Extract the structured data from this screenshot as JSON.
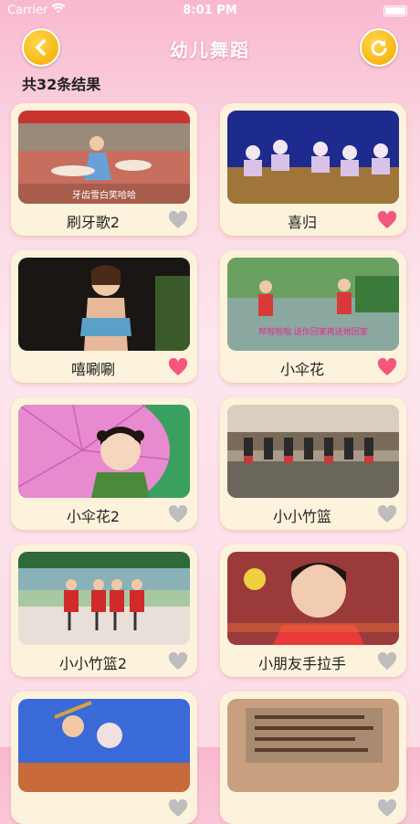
{
  "status_bar": {
    "carrier": "Carrier",
    "time": "8:01 PM"
  },
  "nav": {
    "title": "幼儿舞蹈",
    "back_icon": "chevron-left-icon",
    "refresh_icon": "refresh-icon"
  },
  "result_count": "共32条结果",
  "colors": {
    "heart_on": "#f4567e",
    "heart_off": "#bdbdbd",
    "accent": "#f5b400",
    "card_bg": "#fdf3dc"
  },
  "items": [
    {
      "title": "刷牙歌2",
      "caption": "牙齿雪白笑哈哈",
      "liked": false
    },
    {
      "title": "喜归",
      "caption": "",
      "liked": true
    },
    {
      "title": "嘻唰唰",
      "caption": "",
      "liked": true
    },
    {
      "title": "小伞花",
      "caption": "哗啦啦啦 送你回家再送她回家",
      "liked": true
    },
    {
      "title": "小伞花2",
      "caption": "",
      "liked": false
    },
    {
      "title": "小小竹篮",
      "caption": "",
      "liked": false
    },
    {
      "title": "小小竹篮2",
      "caption": "",
      "liked": false
    },
    {
      "title": "小朋友手拉手",
      "caption": "",
      "liked": false
    },
    {
      "title": "",
      "caption": "",
      "liked": false
    },
    {
      "title": "",
      "caption": "",
      "liked": false
    }
  ]
}
